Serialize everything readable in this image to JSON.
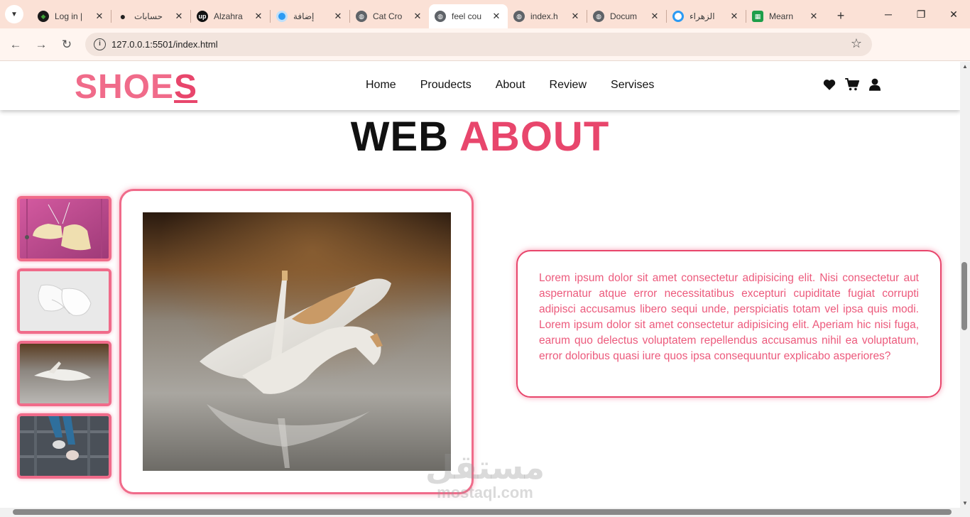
{
  "browser": {
    "tabs": [
      {
        "title": "Log in |",
        "favicon": "mongodb-leaf-icon",
        "color": "#1a1a1a"
      },
      {
        "title": "حسابات",
        "favicon": "dot-icon",
        "color": "#222222"
      },
      {
        "title": "Alzahra",
        "favicon": "upwork-icon",
        "color": "#111111"
      },
      {
        "title": "إضافة",
        "favicon": "circle-icon",
        "color": "#2b9af3"
      },
      {
        "title": "Cat Cro",
        "favicon": "globe-icon",
        "color": "#5f6368"
      },
      {
        "title": "feel cou",
        "favicon": "globe-icon",
        "color": "#5f6368"
      },
      {
        "title": "index.h",
        "favicon": "globe-icon",
        "color": "#5f6368"
      },
      {
        "title": "Docum",
        "favicon": "globe-icon",
        "color": "#5f6368"
      },
      {
        "title": "الزهراء",
        "favicon": "ring-icon",
        "color": "#2b9af3"
      },
      {
        "title": "Mearn",
        "favicon": "sheets-icon",
        "color": "#1e9e4a"
      }
    ],
    "active_tab_index": 5,
    "url": "127.0.0.1:5501/index.html"
  },
  "site": {
    "logo_main": "SHOE",
    "logo_last": "S",
    "nav": [
      "Home",
      "Proudects",
      "About",
      "Review",
      "Servises"
    ],
    "header_icons": [
      "heart-icon",
      "cart-icon",
      "user-icon"
    ],
    "section_title_a": "WEB",
    "section_title_b": "ABOUT",
    "about_text": "Lorem ipsum dolor sit amet consectetur adipisicing elit. Nisi consectetur aut aspernatur atque error necessitatibus excepturi cupiditate fugiat corrupti adipisci accusamus libero sequi unde, perspiciatis totam vel ipsa quis modi. Lorem ipsum dolor sit amet consectetur adipisicing elit. Aperiam hic nisi fuga, earum quo delectus voluptatem repellendus accusamus nihil ea voluptatum, error doloribus quasi iure quos ipsa consequuntur explicabo asperiores?",
    "thumbnails": [
      "hanging-cream-sneakers",
      "white-sneakers-top-view",
      "white-heels-on-table",
      "legs-with-sneakers"
    ],
    "main_image": "white-high-heels"
  },
  "watermark": {
    "arabic": "مستقل",
    "latin": "mostaql.com"
  },
  "colors": {
    "accent": "#e8466c",
    "accent_light": "#f06b8a",
    "tab_bar": "#fbe1d6"
  }
}
